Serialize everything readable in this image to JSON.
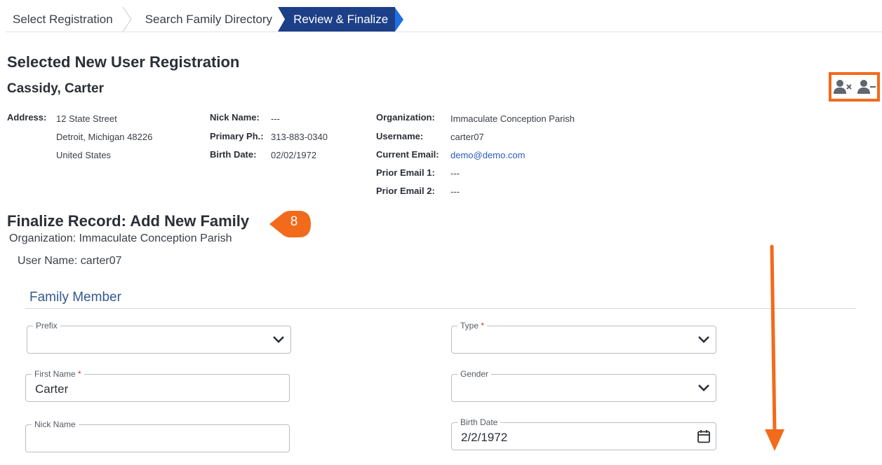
{
  "breadcrumb": {
    "step1": "Select Registration",
    "step2": "Search Family Directory",
    "step3": "Review & Finalize"
  },
  "registration": {
    "section_title": "Selected New User Registration",
    "name": "Cassidy, Carter",
    "address_label": "Address:",
    "address_line1": "12 State Street",
    "address_line2": "Detroit, Michigan 48226",
    "address_line3": "United States",
    "nick_name_label": "Nick Name:",
    "nick_name": "---",
    "primary_phone_label": "Primary Ph.:",
    "primary_phone": "313-883-0340",
    "birth_date_label": "Birth Date:",
    "birth_date": "02/02/1972",
    "organization_label": "Organization:",
    "organization": "Immaculate Conception Parish",
    "username_label": "Username:",
    "username": "carter07",
    "current_email_label": "Current Email:",
    "current_email": "demo@demo.com",
    "prior_email1_label": "Prior Email 1:",
    "prior_email1": "---",
    "prior_email2_label": "Prior Email 2:",
    "prior_email2": "---"
  },
  "actions": {
    "icons": [
      "user-remove-x-icon",
      "user-minus-icon"
    ]
  },
  "finalize": {
    "title": "Finalize Record: Add New Family",
    "callout_number": "8",
    "organization_line": "Organization: Immaculate Conception Parish",
    "username_line": "User Name: carter07"
  },
  "family_member": {
    "section_title": "Family Member",
    "prefix_label": "Prefix",
    "prefix_value": "",
    "type_label": "Type",
    "type_value": "",
    "first_name_label": "First Name",
    "first_name_value": "Carter",
    "gender_label": "Gender",
    "gender_value": "",
    "nick_name_label": "Nick Name",
    "nick_name_value": "",
    "birth_date_label": "Birth Date",
    "birth_date_value": "2/2/1972",
    "required_mark": "*"
  },
  "colors": {
    "accent_orange": "#f26a1b",
    "breadcrumb_active": "#1c3f88",
    "link_blue": "#2a5bb8",
    "section_blue": "#34588e"
  }
}
